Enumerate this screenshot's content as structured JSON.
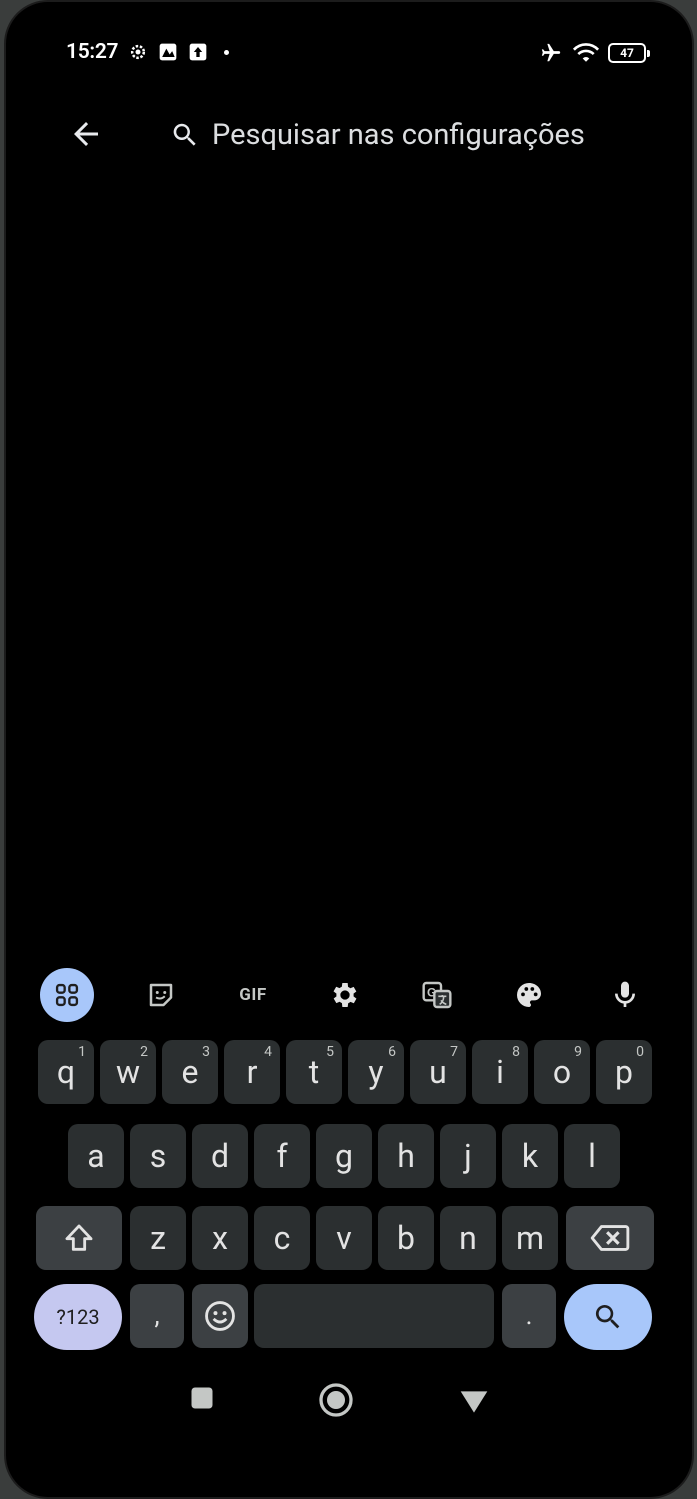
{
  "status_bar": {
    "time": "15:27",
    "battery": "47"
  },
  "header": {
    "search_placeholder": "Pesquisar nas configurações"
  },
  "keyboard": {
    "row1": [
      {
        "letter": "q",
        "hint": "1"
      },
      {
        "letter": "w",
        "hint": "2"
      },
      {
        "letter": "e",
        "hint": "3"
      },
      {
        "letter": "r",
        "hint": "4"
      },
      {
        "letter": "t",
        "hint": "5"
      },
      {
        "letter": "y",
        "hint": "6"
      },
      {
        "letter": "u",
        "hint": "7"
      },
      {
        "letter": "i",
        "hint": "8"
      },
      {
        "letter": "o",
        "hint": "9"
      },
      {
        "letter": "p",
        "hint": "0"
      }
    ],
    "row2": [
      "a",
      "s",
      "d",
      "f",
      "g",
      "h",
      "j",
      "k",
      "l"
    ],
    "row3": [
      "z",
      "x",
      "c",
      "v",
      "b",
      "n",
      "m"
    ],
    "symbols_label": "?123",
    "comma_label": ",",
    "period_label": ".",
    "gif_label": "GIF"
  },
  "colors": {
    "accent_blue": "#a8c7fa",
    "symbols_key": "#c5c8f0",
    "key_bg": "#2b2f30"
  },
  "icons": [
    "back-arrow-icon",
    "search-icon",
    "apps-grid-icon",
    "sticker-icon",
    "settings-icon",
    "translate-icon",
    "palette-icon",
    "microphone-icon",
    "shift-icon",
    "backspace-icon",
    "emoji-icon",
    "nav-recents-icon",
    "nav-home-icon",
    "nav-back-icon"
  ]
}
